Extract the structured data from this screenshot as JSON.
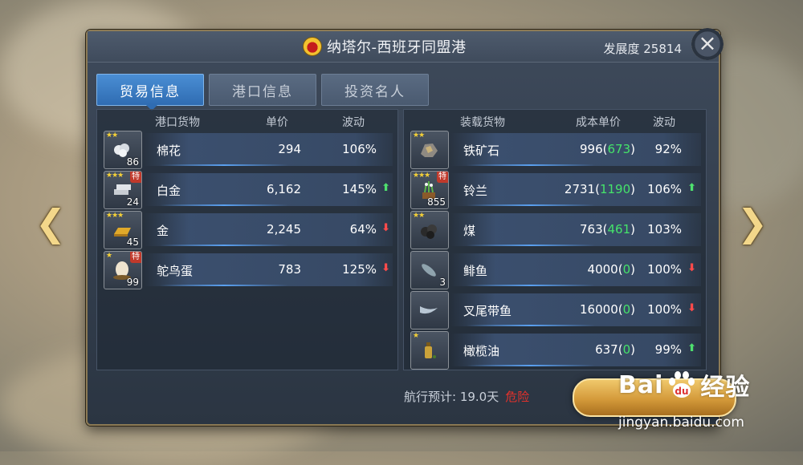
{
  "title": {
    "port_name": "纳塔尔-西班牙同盟港",
    "development": "发展度 25814"
  },
  "tabs": [
    {
      "label": "贸易信息",
      "active": true
    },
    {
      "label": "港口信息",
      "active": false
    },
    {
      "label": "投资名人",
      "active": false
    }
  ],
  "port_goods": {
    "headers": {
      "goods": "港口货物",
      "price": "单价",
      "fluct": "波动"
    },
    "rows": [
      {
        "name": "棉花",
        "price": "294",
        "fluct": "106%",
        "trend": "",
        "stars": "★★",
        "special": "",
        "qty": "86",
        "icon": "cotton-icon"
      },
      {
        "name": "白金",
        "price": "6,162",
        "fluct": "145%",
        "trend": "up",
        "stars": "★★★",
        "special": "特",
        "qty": "24",
        "icon": "platinum-icon"
      },
      {
        "name": "金",
        "price": "2,245",
        "fluct": "64%",
        "trend": "down",
        "stars": "★★★",
        "special": "",
        "qty": "45",
        "icon": "gold-bar-icon"
      },
      {
        "name": "鸵鸟蛋",
        "price": "783",
        "fluct": "125%",
        "trend": "down",
        "stars": "★",
        "special": "特",
        "qty": "99",
        "icon": "ostrich-egg-icon"
      }
    ]
  },
  "cargo_goods": {
    "headers": {
      "goods": "装载货物",
      "cost": "成本单价",
      "fluct": "波动"
    },
    "rows": [
      {
        "name": "铁矿石",
        "cost": "996",
        "ref": "673",
        "fluct": "92%",
        "trend": "",
        "stars": "★★",
        "special": "",
        "qty": "",
        "icon": "iron-ore-icon"
      },
      {
        "name": "铃兰",
        "cost": "2731",
        "ref": "1190",
        "fluct": "106%",
        "trend": "up",
        "stars": "★★★",
        "special": "特",
        "qty": "855",
        "icon": "lily-icon"
      },
      {
        "name": "煤",
        "cost": "763",
        "ref": "461",
        "fluct": "103%",
        "trend": "",
        "stars": "★★",
        "special": "",
        "qty": "",
        "icon": "coal-icon"
      },
      {
        "name": "鲱鱼",
        "cost": "4000",
        "ref": "0",
        "fluct": "100%",
        "trend": "down",
        "stars": "",
        "special": "",
        "qty": "3",
        "icon": "herring-icon"
      },
      {
        "name": "叉尾带鱼",
        "cost": "16000",
        "ref": "0",
        "fluct": "100%",
        "trend": "down",
        "stars": "",
        "special": "",
        "qty": "",
        "icon": "hairtail-icon"
      },
      {
        "name": "橄榄油",
        "cost": "637",
        "ref": "0",
        "fluct": "99%",
        "trend": "up",
        "stars": "★",
        "special": "",
        "qty": "",
        "icon": "olive-oil-icon"
      }
    ]
  },
  "footer": {
    "voyage": "航行预计: 19.0天",
    "danger": "危险"
  },
  "watermark": {
    "big_left": "Bai",
    "big_right": "经验",
    "url": "jingyan.baidu.com"
  },
  "colors": {
    "accent": "#2f6cb2",
    "gain": "#45e36a",
    "loss": "#ff4a4a",
    "danger": "#e4312b"
  }
}
